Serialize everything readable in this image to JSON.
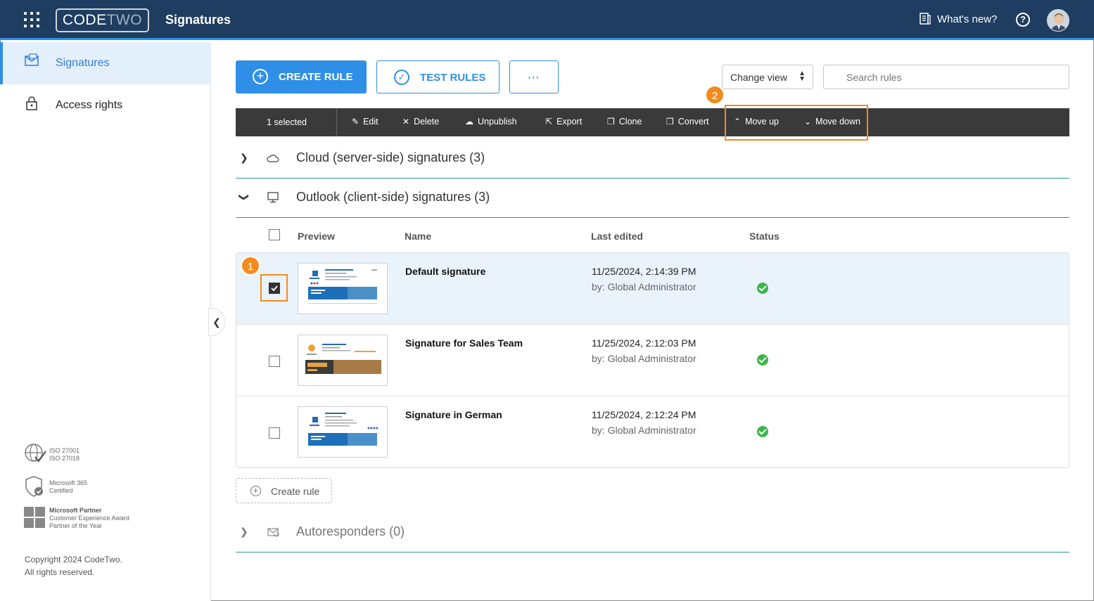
{
  "header": {
    "logo_code": "CODE",
    "logo_two": "TWO",
    "app_title": "Signatures",
    "whats_new": "What's new?",
    "help": "?"
  },
  "sidebar": {
    "items": [
      {
        "label": "Signatures",
        "icon": "signatures-icon",
        "active": true
      },
      {
        "label": "Access rights",
        "icon": "lock-icon",
        "active": false
      }
    ],
    "certs": [
      {
        "lines": [
          "ISO 27001",
          "ISO 27018"
        ],
        "icon": "iso-globe-icon"
      },
      {
        "lines": [
          "Microsoft 365",
          "Certified"
        ],
        "icon": "shield-check-icon"
      },
      {
        "lines": [
          "Microsoft Partner",
          "Customer Experience Award",
          "Partner of the Year"
        ],
        "icon": "microsoft-logo-icon"
      }
    ],
    "copyright_line1": "Copyright 2024 CodeTwo.",
    "copyright_line2": "All rights reserved."
  },
  "actions": {
    "create_rule": "CREATE RULE",
    "test_rules": "TEST RULES",
    "more": "···",
    "change_view": "Change view",
    "search_placeholder": "Search rules"
  },
  "toolbar": {
    "selected": "1 selected",
    "edit": "Edit",
    "delete": "Delete",
    "unpublish": "Unpublish",
    "export": "Export",
    "clone": "Clone",
    "convert": "Convert",
    "move_up": "Move up",
    "move_down": "Move down"
  },
  "annotations": {
    "badge1": "1",
    "badge2": "2",
    "color": "#f28c1e"
  },
  "sections": {
    "cloud": "Cloud (server-side) signatures (3)",
    "outlook": "Outlook (client-side) signatures (3)",
    "autoresponders": "Autoresponders (0)"
  },
  "table": {
    "columns": {
      "preview": "Preview",
      "name": "Name",
      "last_edited": "Last edited",
      "status": "Status"
    },
    "rows": [
      {
        "name": "Default signature",
        "date": "11/25/2024, 2:14:39 PM",
        "by": "by: Global Administrator",
        "checked": true,
        "status": "ok"
      },
      {
        "name": "Signature for Sales Team",
        "date": "11/25/2024, 2:12:03 PM",
        "by": "by: Global Administrator",
        "checked": false,
        "status": "ok"
      },
      {
        "name": "Signature in German",
        "date": "11/25/2024, 2:12:24 PM",
        "by": "by: Global Administrator",
        "checked": false,
        "status": "ok"
      }
    ]
  },
  "create_rule_link": "Create rule",
  "colors": {
    "header": "#1e3d60",
    "accent": "#2f8fe6",
    "toolbar": "#3a3a3a",
    "status_ok": "#3cb44b"
  }
}
